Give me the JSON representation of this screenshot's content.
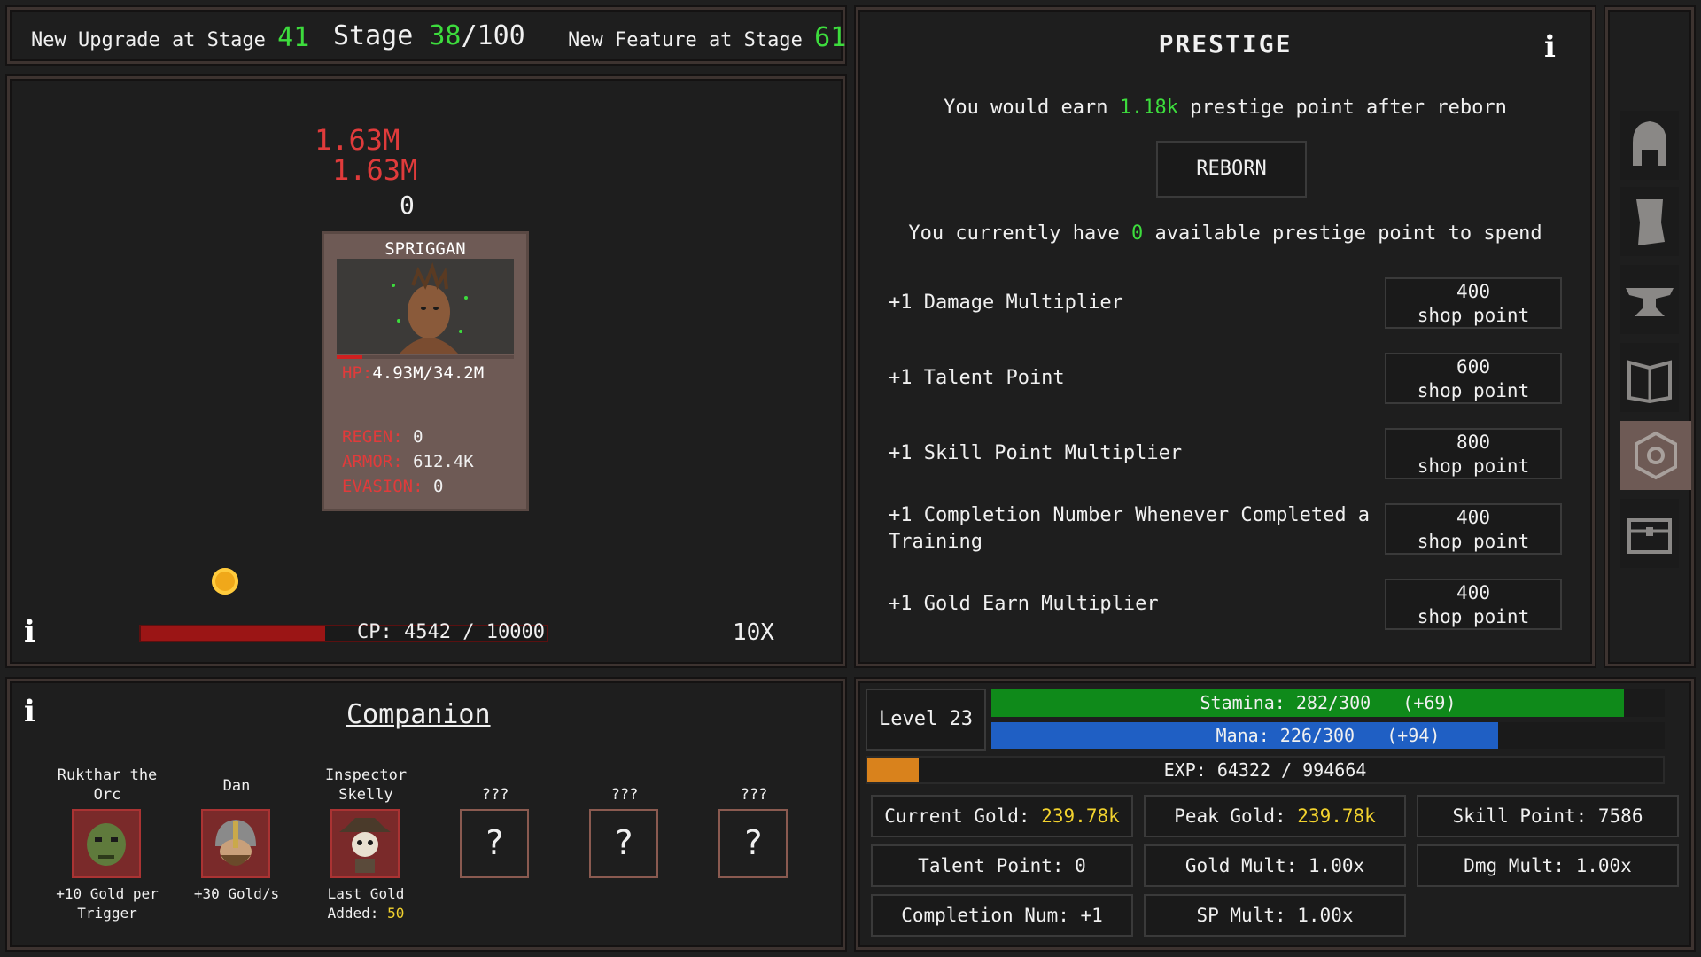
{
  "topbar": {
    "upgrade_label": "New Upgrade at Stage",
    "upgrade_stage": "41",
    "stage_label": "Stage",
    "stage_current": "38",
    "stage_total": "/100",
    "feature_label": "New Feature at Stage",
    "feature_stage": "61"
  },
  "battle": {
    "damage_1": "1.63M",
    "damage_2": "1.63M",
    "counter": "0",
    "enemy": {
      "name": "SPRIGGAN",
      "hp_label": "HP:",
      "hp_value": "4.93M/34.2M",
      "hp_fraction": 0.144,
      "regen_label": "REGEN:",
      "regen_value": "0",
      "armor_label": "ARMOR:",
      "armor_value": "612.4K",
      "evasion_label": "EVASION:",
      "evasion_value": "0"
    },
    "cp_label": "CP:",
    "cp_value": "4542 / 10000",
    "cp_fraction": 0.4542,
    "multiplier": "10X",
    "info": "i"
  },
  "prestige": {
    "title": "PRESTIGE",
    "info": "i",
    "earn_prefix": "You would earn",
    "earn_value": "1.18k",
    "earn_suffix": "prestige point after reborn",
    "reborn_label": "REBORN",
    "have_prefix": "You currently have",
    "have_value": "0",
    "have_suffix": "available prestige point to spend",
    "items": [
      {
        "label": "+1 Damage Multiplier",
        "cost": "400",
        "unit": "shop point"
      },
      {
        "label": "+1 Talent Point",
        "cost": "600",
        "unit": "shop point"
      },
      {
        "label": "+1 Skill Point Multiplier",
        "cost": "800",
        "unit": "shop point"
      },
      {
        "label": "+1 Completion Number Whenever Completed a",
        "label2": "Training",
        "cost": "400",
        "unit": "shop point"
      },
      {
        "label": "+1 Gold Earn Multiplier",
        "cost": "400",
        "unit": "shop point"
      }
    ]
  },
  "sidebar": {
    "icons": [
      "helmet-icon",
      "scroll-icon",
      "anvil-icon",
      "book-icon",
      "spiral-icon",
      "chest-icon"
    ]
  },
  "companion": {
    "title": "Companion",
    "info": "i",
    "slots": [
      {
        "name_1": "Rukthar the",
        "name_2": "Orc",
        "desc_1": "+10 Gold per",
        "desc_2": "Trigger"
      },
      {
        "name_1": "",
        "name_2": "Dan",
        "desc_1": "+30 Gold/s",
        "desc_2": ""
      },
      {
        "name_1": "Inspector",
        "name_2": "Skelly",
        "desc_1": "Last Gold",
        "desc_2": "Added:",
        "desc_value": "50"
      },
      {
        "name_2": "???",
        "glyph": "?"
      },
      {
        "name_2": "???",
        "glyph": "?"
      },
      {
        "name_2": "???",
        "glyph": "?"
      }
    ]
  },
  "stats": {
    "level": "Level 23",
    "stamina": "Stamina: 282/300",
    "stamina_bonus": "(+69)",
    "stamina_fraction": 0.94,
    "mana": "Mana: 226/300",
    "mana_bonus": "(+94)",
    "mana_fraction": 0.753,
    "exp": "EXP: 64322 / 994664",
    "exp_fraction": 0.0647,
    "current_gold_label": "Current Gold:",
    "current_gold_value": "239.78k",
    "peak_gold_label": "Peak Gold:",
    "peak_gold_value": "239.78k",
    "skill_point": "Skill Point: 7586",
    "talent_point": "Talent Point: 0",
    "gold_mult": "Gold Mult: 1.00x",
    "dmg_mult": "Dmg Mult: 1.00x",
    "completion_num": "Completion Num: +1",
    "sp_mult": "SP Mult: 1.00x"
  },
  "colors": {
    "green_text": "#3ddc3d",
    "yellow_text": "#f2d22e",
    "damage_red": "#e03b3b",
    "stamina_bar": "#0f8a1a",
    "mana_bar": "#1f5fc4",
    "exp_bar": "#d9821c"
  }
}
